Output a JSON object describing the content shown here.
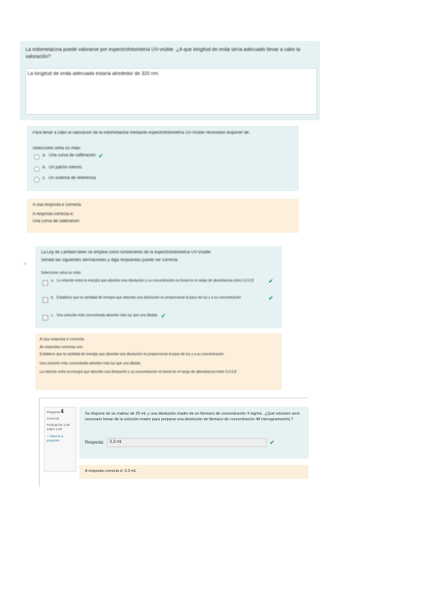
{
  "q1": {
    "question": "La indometacina puede valorarse por espectrofotometría UV-visible. ¿A que longitud de onda sería adecuado llevar a cabo la valoración?",
    "answer": "La longitud de onda adecuada estaría alrededor de 320 nm."
  },
  "q2": {
    "question": "Para llevar a cabo la valoración de la indometacina mediante espectrofotometría UV-Visible necesitaré disponer de:",
    "prompt": "Seleccione unha ou máis:",
    "options": [
      {
        "letter": "a.",
        "text": "Una curva de calibración"
      },
      {
        "letter": "b.",
        "text": "Un patrón interno"
      },
      {
        "letter": "c.",
        "text": "Un sistema de referencia"
      }
    ],
    "feedback": {
      "status": "A súa resposta é correcta.",
      "label": "A resposta correcta é:",
      "correct": "Una curva de calibración"
    }
  },
  "q3": {
    "question": "La Ley de Lambert-Beer se emplea como fundamento de la espectrofotometría UV-Visible.",
    "hint": "Señale las siguientes afirmaciones y diga respuestas puede ser correcta",
    "prompt": "Seleccione unha ou máis:",
    "options": [
      {
        "letter": "a.",
        "text": "La relación entre la energía que absorbe una disolución y su concentración es lineal en el rango de absorbancia entre 0,2-0,8"
      },
      {
        "letter": "b.",
        "text": "Establece que la cantidad de energía que absorbe una disolución es proporcional al paso de luz y a su concentración"
      },
      {
        "letter": "c.",
        "text": "Una solución más concentrada absorbe más luz que una diluida."
      }
    ],
    "feedback": {
      "status": "A súa resposta é correcta.",
      "label": "As respostas correctas son:",
      "lines": [
        "Establece que la cantidad de energía que absorbe una disolución es proporcional al paso de luz y a su concentración",
        "Una solución más concentrada absorbe más luz que una diluida.",
        "La relación entre la energía que absorbe una disolución y su concentración es lineal en el rango de absorbancia entre 0,2-0,8"
      ]
    }
  },
  "q4": {
    "info": {
      "label": "Pregunta",
      "number": "4",
      "state": "Correcta",
      "score": "Puntuación 1,00 sobre 1,00",
      "flag": "Marcar a pregunta"
    },
    "question": "Se dispone de un matraz de 25 mL y una disolución madre de un fármaco de concentración 4 mg/mL. ¿Qué volumen será necesario tomar de la solución madre para preparar una disolución  de fármaco de concentración 48 microgramos/mL?",
    "response_label": "Resposta:",
    "response_value": "0,3 ml",
    "feedback": "A resposta correcta é: 0,3 mL"
  },
  "side_marker": ">",
  "colors": {
    "question_bg": "#e5f1f3",
    "feedback_bg": "#fcefdc",
    "correct": "#3aa06a"
  }
}
